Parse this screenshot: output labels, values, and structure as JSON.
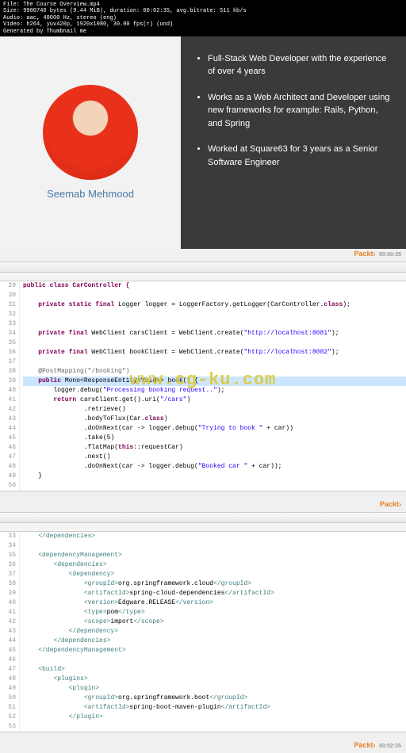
{
  "meta": {
    "line1": "File: The Course Overview.mp4",
    "line2": "Size: 9900740 bytes (9.44 MiB), duration: 00:02:35, avg.bitrate: 511 kb/s",
    "line3": "Audio: aac, 48000 Hz, stereo (eng)",
    "line4": "Video: h264, yuv420p, 1920x1080, 30.00 fps(r) (und)",
    "line5": "Generated by Thumbnail me"
  },
  "slide": {
    "name": "Seemab Mehmood",
    "bullets": [
      "Full-Stack Web Developer with the experience of over 4 years",
      "Works as a Web Architect and Developer using new frameworks for example: Rails, Python, and Spring",
      "Worked at Square63 for 3 years as a Senior Software Engineer"
    ]
  },
  "packt": {
    "label": "Packt›",
    "time1": "00:00:35",
    "time2": "00:02:35"
  },
  "watermark": "www.cg-ku.com",
  "code1": {
    "lines": [
      29,
      30,
      31,
      32,
      33,
      34,
      35,
      36,
      37,
      38,
      39,
      40,
      41,
      42,
      43,
      44,
      45,
      46,
      47,
      48,
      49,
      50
    ],
    "l29": "public class CarController {",
    "l31a": "    private static final ",
    "l31b": "Logger",
    "l31c": " logger = LoggerFactory.getLogger(CarController.",
    "l31d": "class",
    "l31e": ");",
    "l34a": "    private final ",
    "l34b": "WebClient",
    "l34c": " carsClient = WebClient.create(",
    "l34d": "\"http://localhost:8081\"",
    "l34e": ");",
    "l36a": "    private final ",
    "l36b": "WebClient",
    "l36c": " bookClient = WebClient.create(",
    "l36d": "\"http://localhost:8082\"",
    "l36e": ");",
    "l38": "    @PostMapping(\"/booking\")",
    "l39a": "    public ",
    "l39b": "Mono<ResponseEntity<Void>>",
    "l39c": " book() {",
    "l40a": "        logger.debug(",
    "l40b": "\"Processing booking request..\"",
    "l40c": ");",
    "l41a": "        return ",
    "l41b": "carsClient.get().uri(",
    "l41c": "\"/cars\"",
    "l41d": ")",
    "l42": "                .retrieve()",
    "l43a": "                .bodyToFlux(Car.",
    "l43b": "class",
    "l43c": ")",
    "l44a": "                .doOnNext(car -> logger.debug(",
    "l44b": "\"Trying to book \"",
    "l44c": " + car))",
    "l45": "                .take(5)",
    "l46a": "                .flatMap(",
    "l46b": "this",
    "l46c": "::requestCar)",
    "l47": "                .next()",
    "l48a": "                .doOnNext(car -> logger.debug(",
    "l48b": "\"Booked car \"",
    "l48c": " + car));",
    "l49": "    }"
  },
  "code2": {
    "lines": [
      33,
      34,
      35,
      36,
      37,
      38,
      39,
      40,
      41,
      42,
      43,
      44,
      45,
      46,
      47,
      48,
      49,
      50,
      51,
      52,
      53
    ],
    "l33": "    </dependencies>",
    "l35": "    <dependencyManagement>",
    "l36": "        <dependencies>",
    "l37": "            <dependency>",
    "l38a": "                <groupId>",
    "l38b": "org.springframework.cloud",
    "l38c": "</groupId>",
    "l39a": "                <artifactId>",
    "l39b": "spring-cloud-dependencies",
    "l39c": "</artifactId>",
    "l40a": "                <version>",
    "l40b": "Edgware.RELEASE",
    "l40c": "</version>",
    "l41a": "                <type>",
    "l41b": "pom",
    "l41c": "</type>",
    "l42a": "                <scope>",
    "l42b": "import",
    "l42c": "</scope>",
    "l43": "            </dependency>",
    "l44": "        </dependencies>",
    "l45": "    </dependencyManagement>",
    "l47": "    <build>",
    "l48": "        <plugins>",
    "l49": "            <plugin>",
    "l50a": "                <groupId>",
    "l50b": "org.springframework.boot",
    "l50c": "</groupId>",
    "l51a": "                <artifactId>",
    "l51b": "spring-boot-maven-plugin",
    "l51c": "</artifactId>",
    "l52": "            </plugin>"
  }
}
